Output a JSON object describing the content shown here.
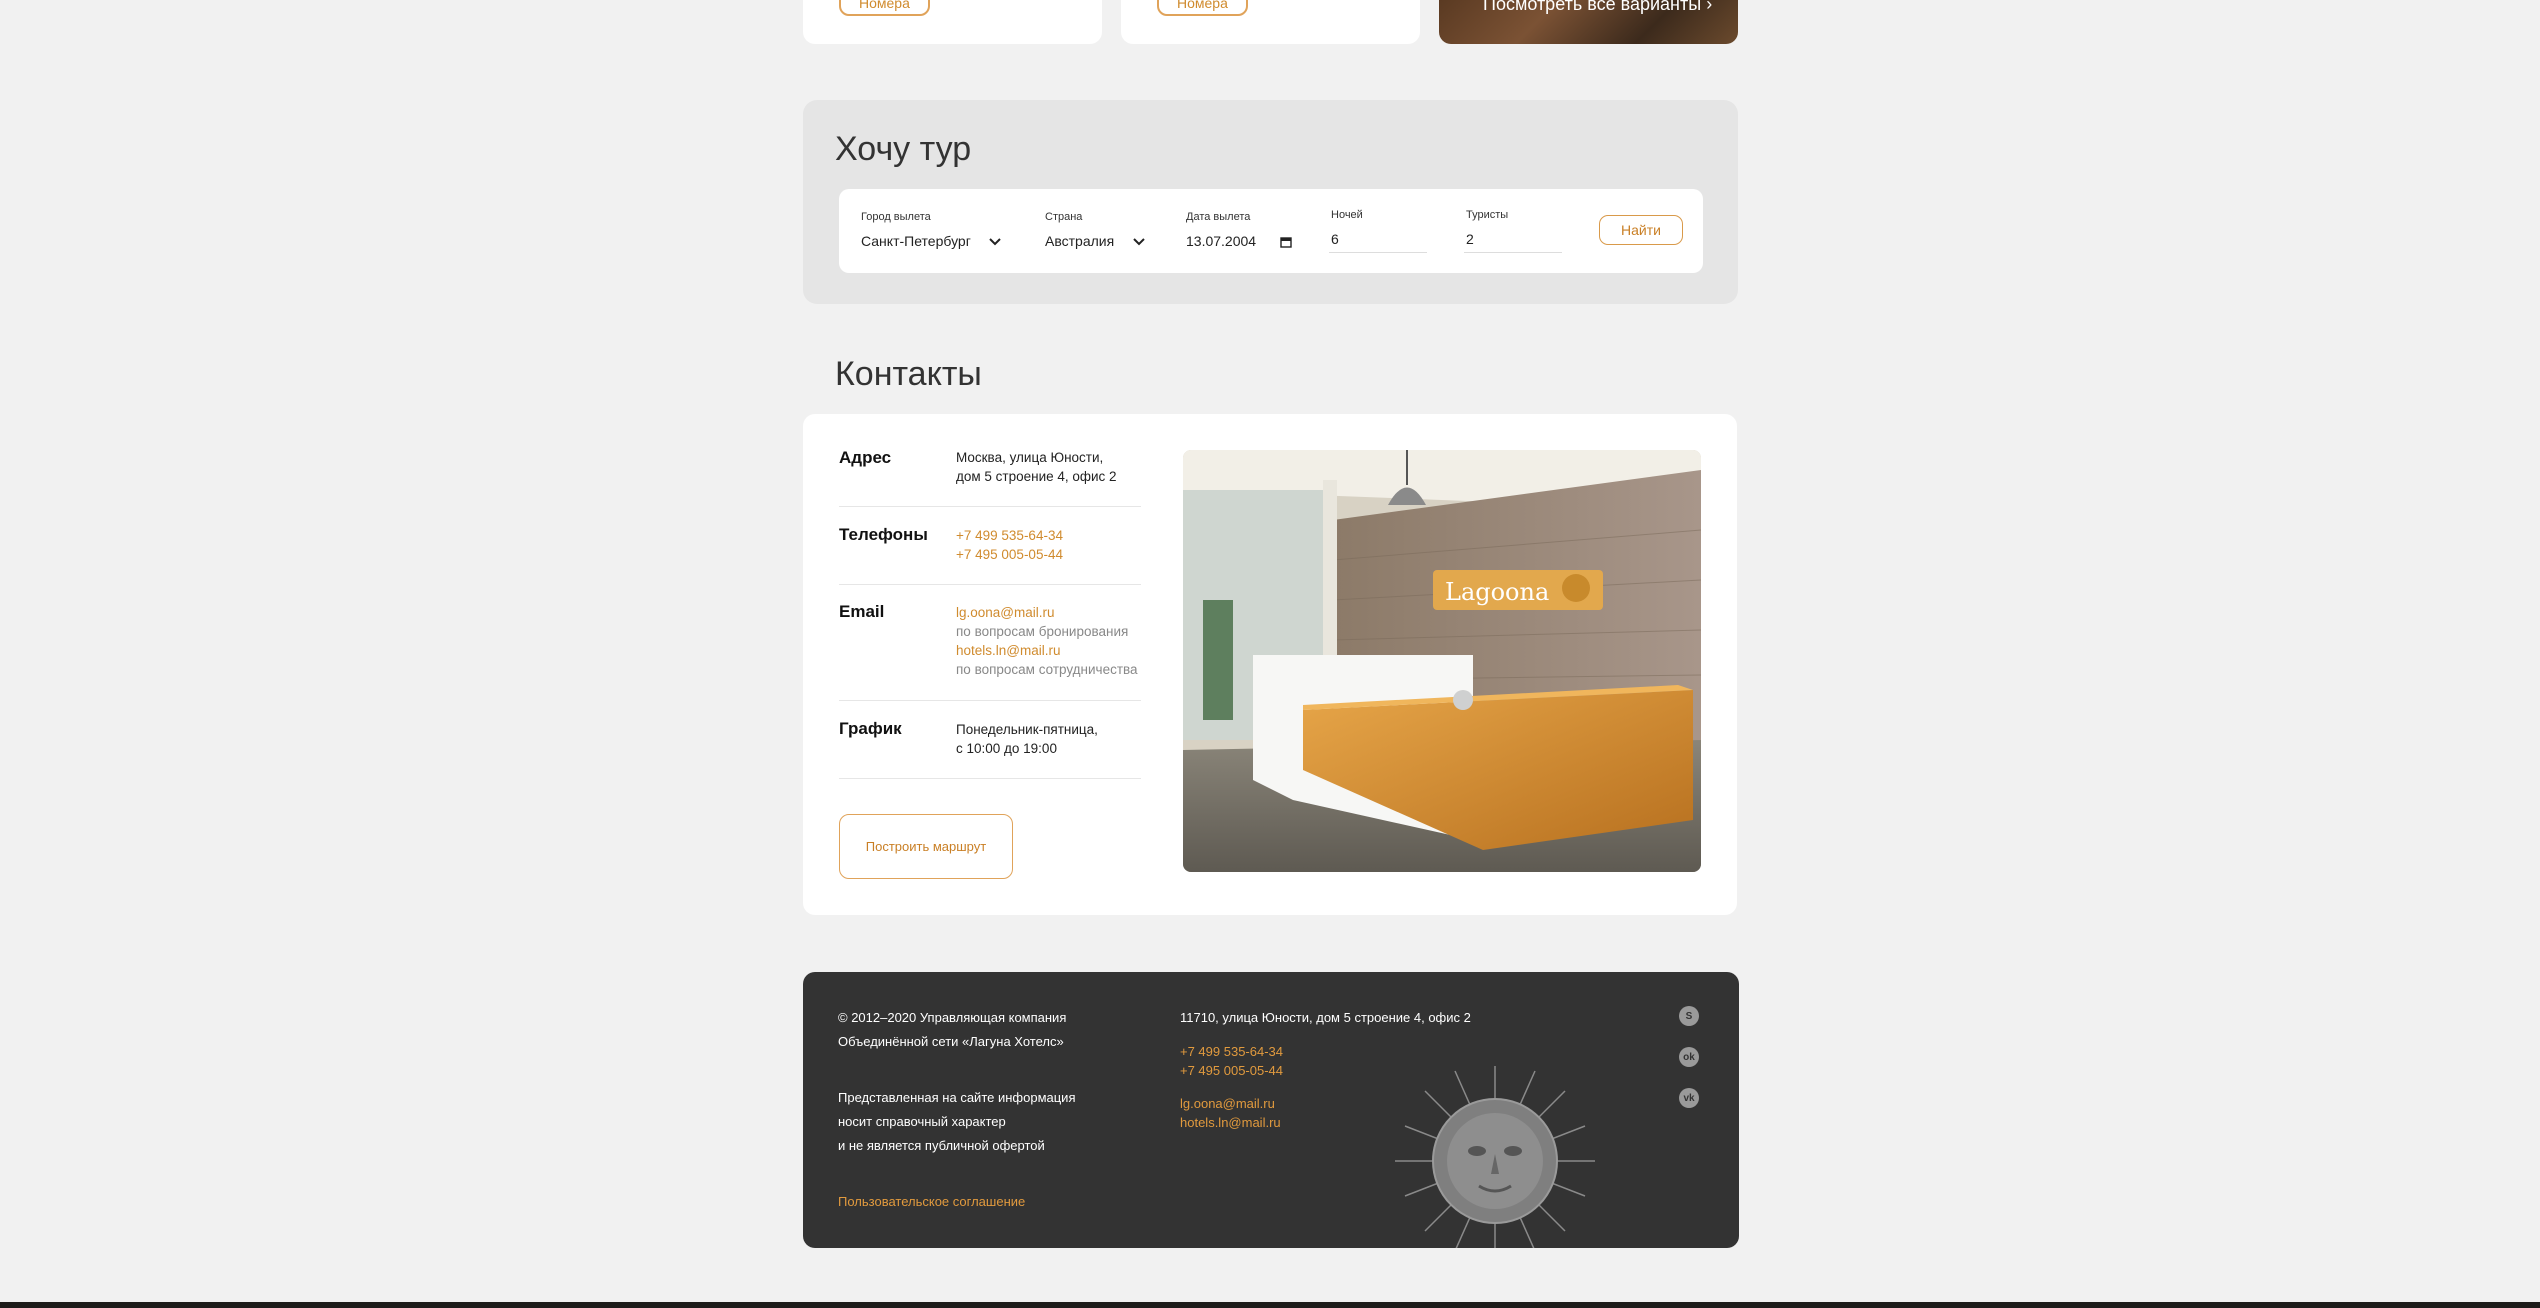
{
  "top_cards": {
    "card1_button": "Номера",
    "card2_button": "Номера",
    "card3_link": "Посмотреть все варианты"
  },
  "tour": {
    "title": "Хочу тур",
    "fields": {
      "city": {
        "label": "Город вылета",
        "value": "Санкт-Петербург"
      },
      "country": {
        "label": "Страна",
        "value": "Австралия"
      },
      "date": {
        "label": "Дата вылета",
        "value": "13.07.2004"
      },
      "nights": {
        "label": "Ночей",
        "value": "6"
      },
      "tourists": {
        "label": "Туристы",
        "value": "2"
      }
    },
    "submit_label": "Найти"
  },
  "contacts": {
    "title": "Контакты",
    "address": {
      "label": "Адрес",
      "line1": "Москва, улица Юности,",
      "line2": "дом 5 строение 4, офис 2"
    },
    "phones": {
      "label": "Телефоны",
      "phone1": "+7 499 535-64-34",
      "phone2": "+7 495 005-05-44"
    },
    "email": {
      "label": "Email",
      "email1": "lg.oona@mail.ru",
      "email1_note": "по вопросам бронирования",
      "email2": "hotels.ln@mail.ru",
      "email2_note": "по вопросам сотрудничества"
    },
    "schedule": {
      "label": "График",
      "line1": "Понедельник-пятница,",
      "line2": "с 10:00 до 19:00"
    },
    "route_button": "Построить маршрут",
    "photo_sign": "Lagoona"
  },
  "footer": {
    "copyright1": "© 2012–2020 Управляющая компания",
    "copyright2": "Объединённой сети «Лагуна Хотелс»",
    "disclaimer1": "Представленная на сайте информация",
    "disclaimer2": "носит справочный характер",
    "disclaimer3": "и не является публичной офертой",
    "agreement": "Пользовательское соглашение",
    "address": "11710, улица Юности, дом 5 строение 4, офис 2",
    "phone1": "+7 499 535-64-34",
    "phone2": "+7 495 005-05-44",
    "email1": "lg.oona@mail.ru",
    "email2": "hotels.ln@mail.ru",
    "socials": [
      "skype-icon",
      "odnoklassniki-icon",
      "vk-icon"
    ]
  },
  "colors": {
    "accent": "#d08b2e",
    "page_bg": "#f1f1f1",
    "footer_bg": "#333333"
  }
}
